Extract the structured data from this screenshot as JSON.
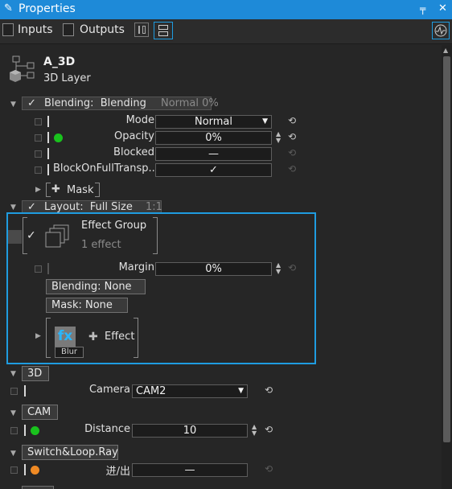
{
  "window": {
    "title": "Properties"
  },
  "toolbar": {
    "inputs_label": "Inputs",
    "outputs_label": "Outputs"
  },
  "layer": {
    "name": "A_3D",
    "type": "3D Layer"
  },
  "blending_header": {
    "check": "✓",
    "label": "Blending:",
    "value": "Blending",
    "summary": "Normal 0%"
  },
  "rows": {
    "mode": {
      "label": "Mode",
      "value": "Normal"
    },
    "opacity": {
      "label": "Opacity",
      "value": "0%"
    },
    "blocked": {
      "label": "Blocked",
      "value": "—"
    },
    "block_transp": {
      "label": "BlockOnFullTransp...",
      "value": "✓"
    }
  },
  "mask": {
    "label": "Mask"
  },
  "layout_header": {
    "check": "✓",
    "label": "Layout:",
    "value": "Full Size",
    "summary": "1:1"
  },
  "effect_group": {
    "check": "✓",
    "title": "Effect Group",
    "count": "1 effect",
    "margin_label": "Margin",
    "margin_value": "0%",
    "blending_btn": "Blending:  None",
    "mask_btn": "Mask:  None",
    "fx_label": "fx",
    "blur_label": "Blur",
    "add_effect": "Effect"
  },
  "section_3d": {
    "label": "3D",
    "camera_label": "Camera",
    "camera_value": "CAM2"
  },
  "section_cam": {
    "label": "CAM",
    "distance_label": "Distance",
    "distance_value": "10"
  },
  "section_switch": {
    "label": "Switch&Loop.Ray",
    "inout_label": "进/出",
    "inout_value": "—"
  },
  "icons": {
    "pencil": "✎",
    "pin": "📌",
    "close": "✕",
    "reset": "⟲",
    "plus": "✚",
    "caret_down": "▼",
    "caret_right": "▶",
    "dropdown": "▼"
  },
  "colors": {
    "title_bar": "#1e8ad8",
    "selection": "#1f9ce0",
    "green_dot": "#19c21d",
    "orange_dot": "#f08a24"
  }
}
